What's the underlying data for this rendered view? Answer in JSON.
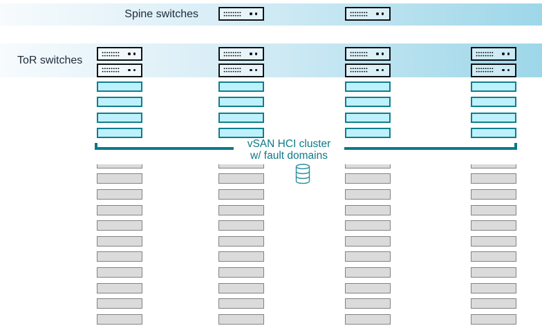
{
  "diagram": {
    "spine": {
      "label": "Spine switches",
      "switch_count": 2
    },
    "tor": {
      "label": "ToR switches",
      "rack_count": 4,
      "switches_per_rack": 2
    },
    "cluster": {
      "label_line1": "vSAN HCI cluster",
      "label_line2": "w/ fault domains",
      "icon": "database-icon",
      "rack_count": 4,
      "vsan_nodes_per_rack": 4,
      "other_server_nodes_per_rack": 11
    },
    "colors": {
      "teal": "#0d7888",
      "db_icon_stroke": "#2b8d9d",
      "band_gradient": [
        "#f7fbfd",
        "#d7edf6",
        "#9dd7e9"
      ],
      "vsan_node_fill": "#bdf1fb",
      "vsan_node_border": "#0f7d8d",
      "server_node_fill": "#dbdbdb",
      "server_node_border": "#818181",
      "switch_border": "#0d1114",
      "label_text": "#202c3c"
    }
  }
}
